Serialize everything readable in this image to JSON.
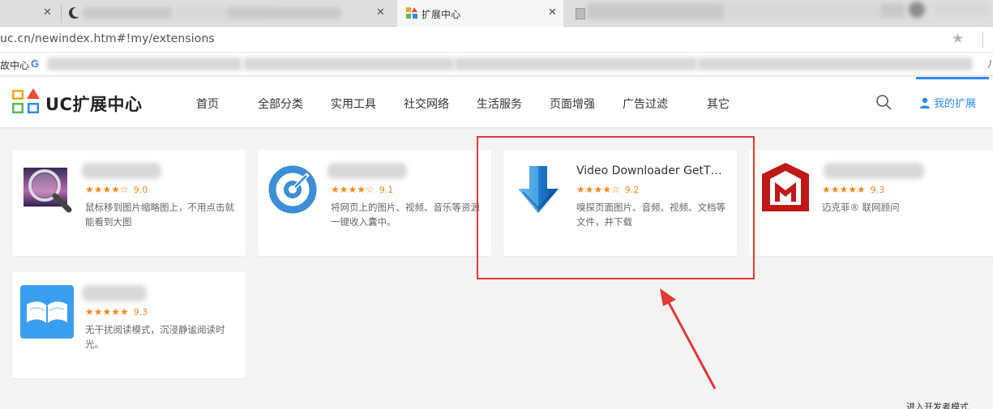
{
  "browser": {
    "tabs": [
      {
        "title": "",
        "state": "blurred"
      },
      {
        "title": "",
        "state": "blurred"
      },
      {
        "title": "扩展中心",
        "state": "active"
      },
      {
        "title": "",
        "state": "blurred"
      }
    ],
    "close_glyph": "✕",
    "url": "uc.cn/newindex.htm#!my/extensions",
    "bookmarks": {
      "first_label": "故中心",
      "trailing": "八"
    }
  },
  "site": {
    "logo_text": "UC扩展中心",
    "nav": [
      "首页",
      "全部分类",
      "实用工具",
      "社交网络",
      "生活服务",
      "页面增强",
      "广告过滤",
      "其它"
    ],
    "my_extensions": "我的扩展"
  },
  "extensions": [
    {
      "name": "",
      "stars": "★★★★☆",
      "score": "9.0",
      "desc": "鼠标移到图片缩略图上，不用点击就能看到大图",
      "icon": "magnifier-photo-icon"
    },
    {
      "name": "",
      "stars": "★★★★☆",
      "score": "9.1",
      "desc": "将网页上的图片、视频、音乐等资源一键收入囊中。",
      "icon": "target-circle-icon"
    },
    {
      "name": "Video Downloader GetThe...",
      "stars": "★★★★☆",
      "score": "9.2",
      "desc": "嗅探页面图片、音频、视频、文档等文件，并下载",
      "icon": "blue-download-arrow-icon"
    },
    {
      "name": "",
      "stars": "★★★★★",
      "score": "9.3",
      "desc": "迈克菲® 联网顾问",
      "icon": "mcafee-shield-icon"
    },
    {
      "name": "",
      "stars": "★★★★★",
      "score": "9.3",
      "desc": "无干扰阅读模式，沉浸静谧阅读时光。",
      "icon": "open-book-icon"
    }
  ],
  "colors": {
    "accent": "#2d8cf0",
    "highlight": "#e23a34",
    "star": "#f08a1d"
  },
  "footer_hint": "进入开发者模式 "
}
